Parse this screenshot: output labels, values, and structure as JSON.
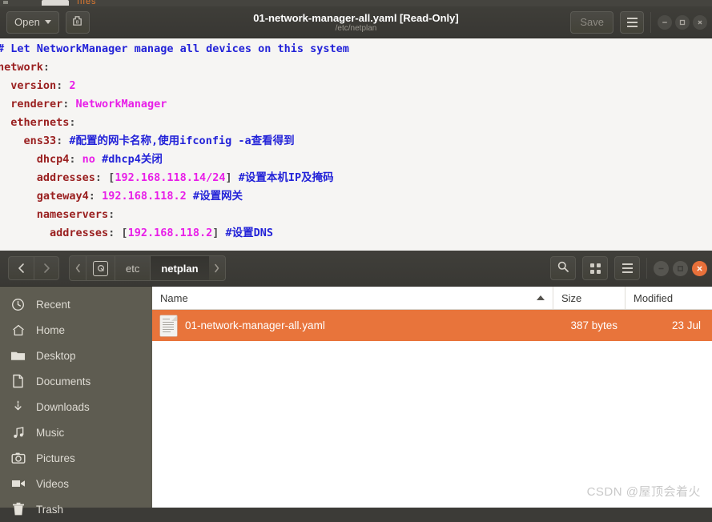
{
  "background_window": {
    "tab_label": "",
    "title_fragment": "files"
  },
  "editor": {
    "open_button": "Open",
    "new_doc_icon": "save-document-icon",
    "title": "01-network-manager-all.yaml [Read-Only]",
    "subtitle": "/etc/netplan",
    "save_button": "Save",
    "menu_icon": "hamburger-menu-icon",
    "window_controls": [
      "minimize",
      "maximize",
      "close"
    ],
    "code_lines": [
      [
        {
          "t": "# Let NetworkManager manage all devices on this system",
          "c": "c-comment"
        }
      ],
      [
        {
          "t": "network",
          "c": "c-key"
        },
        {
          "t": ":",
          "c": "c-colon"
        }
      ],
      [
        {
          "t": "  version",
          "c": "c-key"
        },
        {
          "t": ": ",
          "c": "c-colon"
        },
        {
          "t": "2",
          "c": "c-val"
        }
      ],
      [
        {
          "t": "  renderer",
          "c": "c-key"
        },
        {
          "t": ": ",
          "c": "c-colon"
        },
        {
          "t": "NetworkManager",
          "c": "c-val"
        }
      ],
      [
        {
          "t": "  ethernets",
          "c": "c-key"
        },
        {
          "t": ":",
          "c": "c-colon"
        }
      ],
      [
        {
          "t": "    ens33",
          "c": "c-key"
        },
        {
          "t": ": ",
          "c": "c-colon"
        },
        {
          "t": "#配置的网卡名称,使用ifconfig -a查看得到",
          "c": "c-comment"
        }
      ],
      [
        {
          "t": "      dhcp4",
          "c": "c-key"
        },
        {
          "t": ": ",
          "c": "c-colon"
        },
        {
          "t": "no ",
          "c": "c-val"
        },
        {
          "t": "#dhcp4关闭",
          "c": "c-comment"
        }
      ],
      [
        {
          "t": "      addresses",
          "c": "c-key"
        },
        {
          "t": ": [",
          "c": "c-colon"
        },
        {
          "t": "192.168.118.14/24",
          "c": "c-val"
        },
        {
          "t": "] ",
          "c": "c-colon"
        },
        {
          "t": "#设置本机IP及掩码",
          "c": "c-comment"
        }
      ],
      [
        {
          "t": "      gateway4",
          "c": "c-key"
        },
        {
          "t": ": ",
          "c": "c-colon"
        },
        {
          "t": "192.168.118.2 ",
          "c": "c-val"
        },
        {
          "t": "#设置网关",
          "c": "c-comment"
        }
      ],
      [
        {
          "t": "      nameservers",
          "c": "c-key"
        },
        {
          "t": ":",
          "c": "c-colon"
        }
      ],
      [
        {
          "t": "        addresses",
          "c": "c-key"
        },
        {
          "t": ": [",
          "c": "c-colon"
        },
        {
          "t": "192.168.118.2",
          "c": "c-val"
        },
        {
          "t": "] ",
          "c": "c-colon"
        },
        {
          "t": "#设置DNS",
          "c": "c-comment"
        }
      ]
    ]
  },
  "file_manager": {
    "nav": {
      "back_icon": "chevron-left-icon",
      "forward_icon": "chevron-right-icon"
    },
    "breadcrumbs": [
      {
        "label": "",
        "name": "breadcrumb-scroll-left",
        "type": "arrow-left"
      },
      {
        "label": "",
        "name": "breadcrumb-device-root",
        "type": "disk"
      },
      {
        "label": "etc",
        "name": "breadcrumb-etc",
        "type": "text"
      },
      {
        "label": "netplan",
        "name": "breadcrumb-netplan",
        "type": "text",
        "active": true
      },
      {
        "label": "",
        "name": "breadcrumb-scroll-right",
        "type": "arrow-right"
      }
    ],
    "toolbar_icons": [
      "search-icon",
      "grid-view-icon",
      "hamburger-menu-icon"
    ],
    "window_controls": [
      "minimize",
      "maximize",
      "close"
    ],
    "sidebar": {
      "items": [
        {
          "label": "Recent",
          "icon": "clock-icon"
        },
        {
          "label": "Home",
          "icon": "home-icon"
        },
        {
          "label": "Desktop",
          "icon": "folder-icon"
        },
        {
          "label": "Documents",
          "icon": "document-icon"
        },
        {
          "label": "Downloads",
          "icon": "download-arrow-icon"
        },
        {
          "label": "Music",
          "icon": "music-note-icon"
        },
        {
          "label": "Pictures",
          "icon": "camera-icon"
        },
        {
          "label": "Videos",
          "icon": "video-camera-icon"
        },
        {
          "label": "Trash",
          "icon": "trash-icon"
        }
      ]
    },
    "list": {
      "columns": [
        "Name",
        "Size",
        "Modified"
      ],
      "sort_column": "Name",
      "sort_direction": "ascending",
      "rows": [
        {
          "name": "01-network-manager-all.yaml",
          "size": "387 bytes",
          "modified": "23 Jul",
          "selected": true,
          "icon": "text-file-icon"
        }
      ]
    }
  },
  "watermark": "CSDN @屋顶会着火",
  "colors": {
    "accent_orange": "#e8743b",
    "titlebar_dark": "#3c3b37",
    "sidebar_bg": "#5e5c51",
    "editor_bg": "#f6f5f3",
    "comment_blue": "#2323d8",
    "key_red": "#9a2020",
    "value_magenta": "#e81ee8"
  }
}
